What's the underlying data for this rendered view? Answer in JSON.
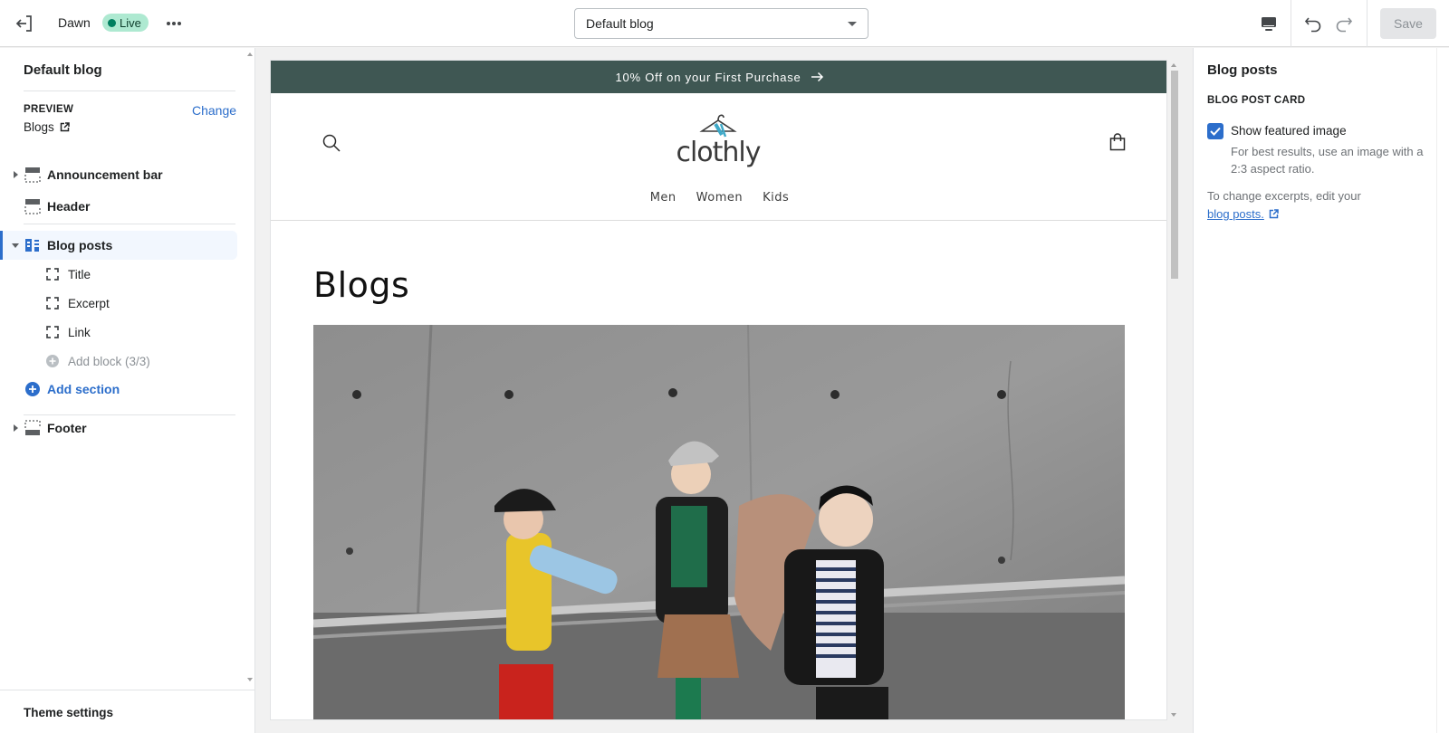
{
  "topbar": {
    "theme_name": "Dawn",
    "live_badge": "Live",
    "template_select": "Default blog",
    "save_label": "Save"
  },
  "left": {
    "title": "Default blog",
    "preview_label": "PREVIEW",
    "change_label": "Change",
    "preview_value": "Blogs",
    "sections": {
      "announcement": "Announcement bar",
      "header": "Header",
      "blog_posts": "Blog posts",
      "footer": "Footer"
    },
    "blocks": [
      "Title",
      "Excerpt",
      "Link"
    ],
    "add_block": "Add block (3/3)",
    "add_section": "Add section",
    "theme_settings": "Theme settings"
  },
  "preview": {
    "announcement": "10% Off on your First Purchase",
    "logo_text": "clothly",
    "nav": [
      "Men",
      "Women",
      "Kids"
    ],
    "page_title": "Blogs"
  },
  "right": {
    "title": "Blog posts",
    "subheading": "BLOG POST CARD",
    "checkbox_label": "Show featured image",
    "checkbox_checked": true,
    "checkbox_help": "For best results, use an image with a 2:3 aspect ratio.",
    "excerpt_text": "To change excerpts, edit your",
    "excerpt_link": "blog posts."
  },
  "colors": {
    "accent": "#2c6ecb",
    "announcement_bg": "#3f5753",
    "live_bg": "#aee9d1",
    "live_dot": "#007f5f"
  }
}
